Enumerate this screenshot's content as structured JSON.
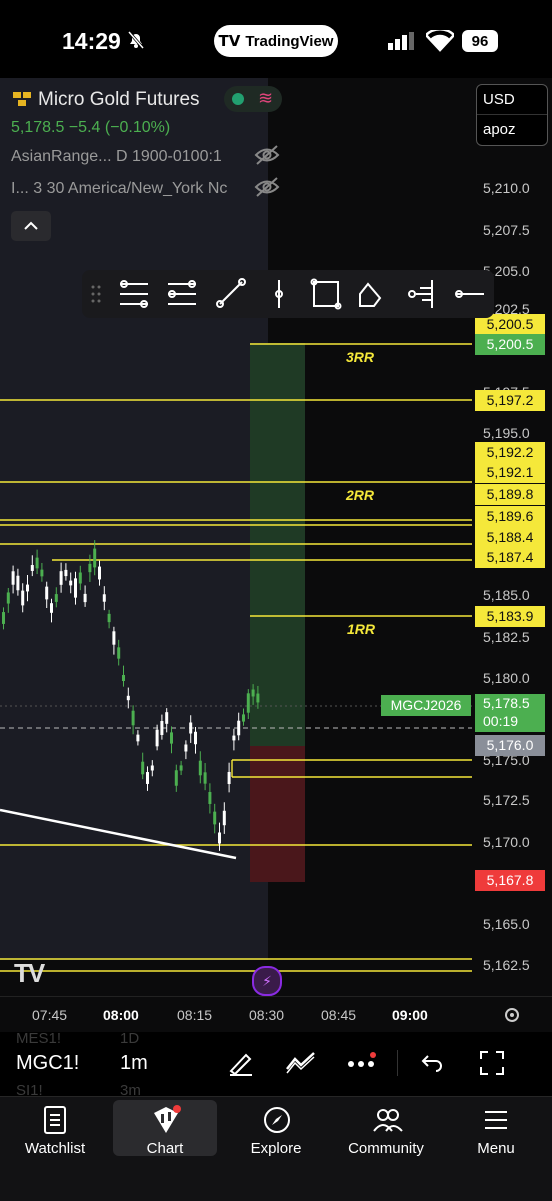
{
  "status_bar": {
    "time": "14:29",
    "app": "TradingView",
    "battery": "96"
  },
  "symbol": {
    "title": "Micro Gold Futures",
    "price_line": "5,178.5  −5.4 (−0.10%)",
    "indicator1": "AsianRange... D 1900-0100:1",
    "indicator2": "I... 3 30 America/New_York Nc"
  },
  "currency": {
    "currency": "USD",
    "account": "apoz"
  },
  "price_axis": [
    "5,210.0",
    "5,207.5",
    "5,205.0",
    "5,202.5",
    "5,197.5",
    "5,195.0",
    "5,185.0",
    "5,182.5",
    "5,180.0",
    "5,175.0",
    "5,172.5",
    "5,170.0",
    "5,165.0",
    "5,162.5"
  ],
  "price_labels": [
    {
      "text": "5,200.5",
      "color": "#f5e83a"
    },
    {
      "text": "5,200.5",
      "color": "#4caf50"
    },
    {
      "text": "5,197.2",
      "color": "#f5e83a"
    },
    {
      "text": "5,192.2",
      "color": "#f5e83a"
    },
    {
      "text": "5,192.1",
      "color": "#f5e83a"
    },
    {
      "text": "5,189.8",
      "color": "#f5e83a"
    },
    {
      "text": "5,189.6",
      "color": "#f5e83a"
    },
    {
      "text": "5,188.4",
      "color": "#f5e83a"
    },
    {
      "text": "5,187.4",
      "color": "#f5e83a"
    },
    {
      "text": "5,183.9",
      "color": "#f5e83a"
    },
    {
      "text": "5,176.0",
      "color": "#8a8f99"
    },
    {
      "text": "5,167.8",
      "color": "#ef3b3b"
    }
  ],
  "current_price": {
    "contract": "MGCJ2026",
    "price": "5,178.5",
    "countdown": "00:19"
  },
  "rr_labels": [
    "3RR",
    "2RR",
    "1RR"
  ],
  "time_axis": [
    "07:45",
    "08:00",
    "08:15",
    "08:30",
    "08:45",
    "09:00"
  ],
  "toolbar": {
    "symbol": "MGC1!",
    "interval": "1m",
    "ghost_symbols": [
      "MES1!",
      "SI1!"
    ],
    "ghost_intervals": [
      "1D",
      "3m"
    ]
  },
  "nav": [
    "Watchlist",
    "Chart",
    "Explore",
    "Community",
    "Menu"
  ],
  "colors": {
    "level_line": "#f5e83a",
    "up_candle": "#4caf50",
    "down_candle": "#ffffff",
    "target_zone": "#1e3d22",
    "stop_zone": "#4a1518"
  }
}
